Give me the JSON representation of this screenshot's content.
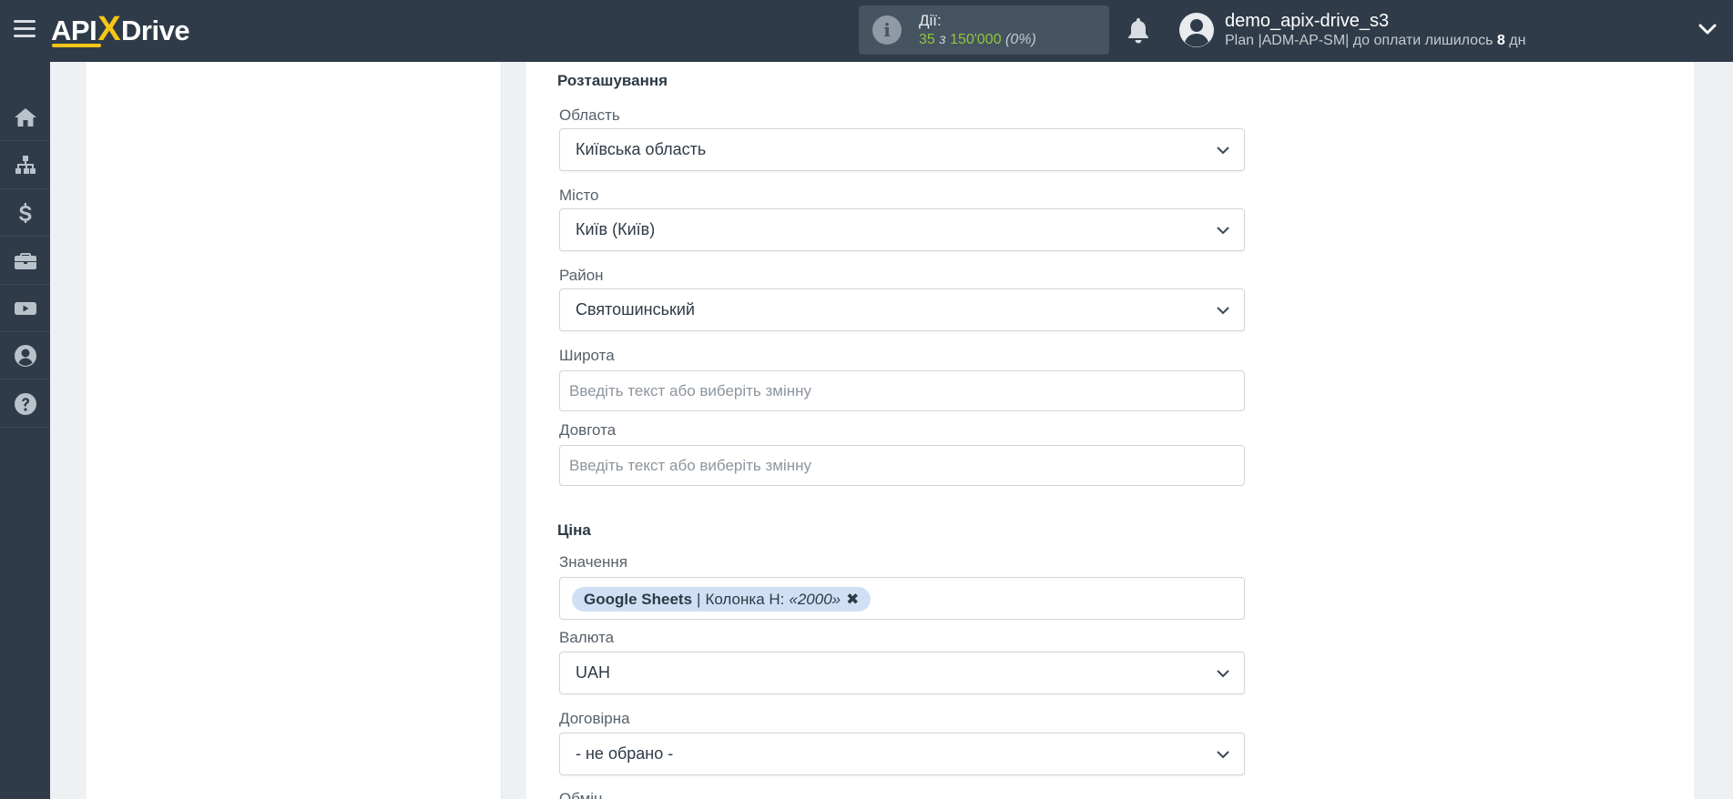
{
  "header": {
    "logo": {
      "left": "API",
      "x": "X",
      "right": "Drive"
    },
    "actions": {
      "label": "Дії:",
      "used": "35",
      "of": "з",
      "total": "150'000",
      "percent": "(0%)"
    },
    "user": {
      "name": "demo_apix-drive_s3",
      "plan_prefix": "Plan |ADM-AP-SM| до оплати лишилось",
      "days": "8",
      "days_suffix": "дн"
    }
  },
  "sidebar": {
    "items": [
      {
        "icon": "home-icon"
      },
      {
        "icon": "sitemap-icon"
      },
      {
        "icon": "dollar-icon"
      },
      {
        "icon": "briefcase-icon"
      },
      {
        "icon": "youtube-icon"
      },
      {
        "icon": "user-icon"
      },
      {
        "icon": "question-icon"
      }
    ]
  },
  "form": {
    "location": {
      "title": "Розташування",
      "region": {
        "label": "Область",
        "value": "Київська область"
      },
      "city": {
        "label": "Місто",
        "value": "Київ (Київ)"
      },
      "district": {
        "label": "Район",
        "value": "Святошинський"
      },
      "latitude": {
        "label": "Широта",
        "placeholder": "Введіть текст або виберіть змінну",
        "value": ""
      },
      "longitude": {
        "label": "Довгота",
        "placeholder": "Введіть текст або виберіть змінну",
        "value": ""
      }
    },
    "price": {
      "title": "Ціна",
      "value": {
        "label": "Значення",
        "tag": {
          "source": "Google Sheets",
          "separator": "|",
          "column": "Колонка H:",
          "sample": "«2000»",
          "remove": "✖"
        }
      },
      "currency": {
        "label": "Валюта",
        "value": "UAH"
      },
      "negotiable": {
        "label": "Договірна",
        "value": "- не обрано -"
      },
      "exchange": {
        "label": "Обмін"
      }
    }
  },
  "colors": {
    "topbar": "#2f3b48",
    "accent_green": "#8ec63f",
    "logo_yellow": "#f5c518",
    "tag_bg": "#cfe0f5"
  }
}
